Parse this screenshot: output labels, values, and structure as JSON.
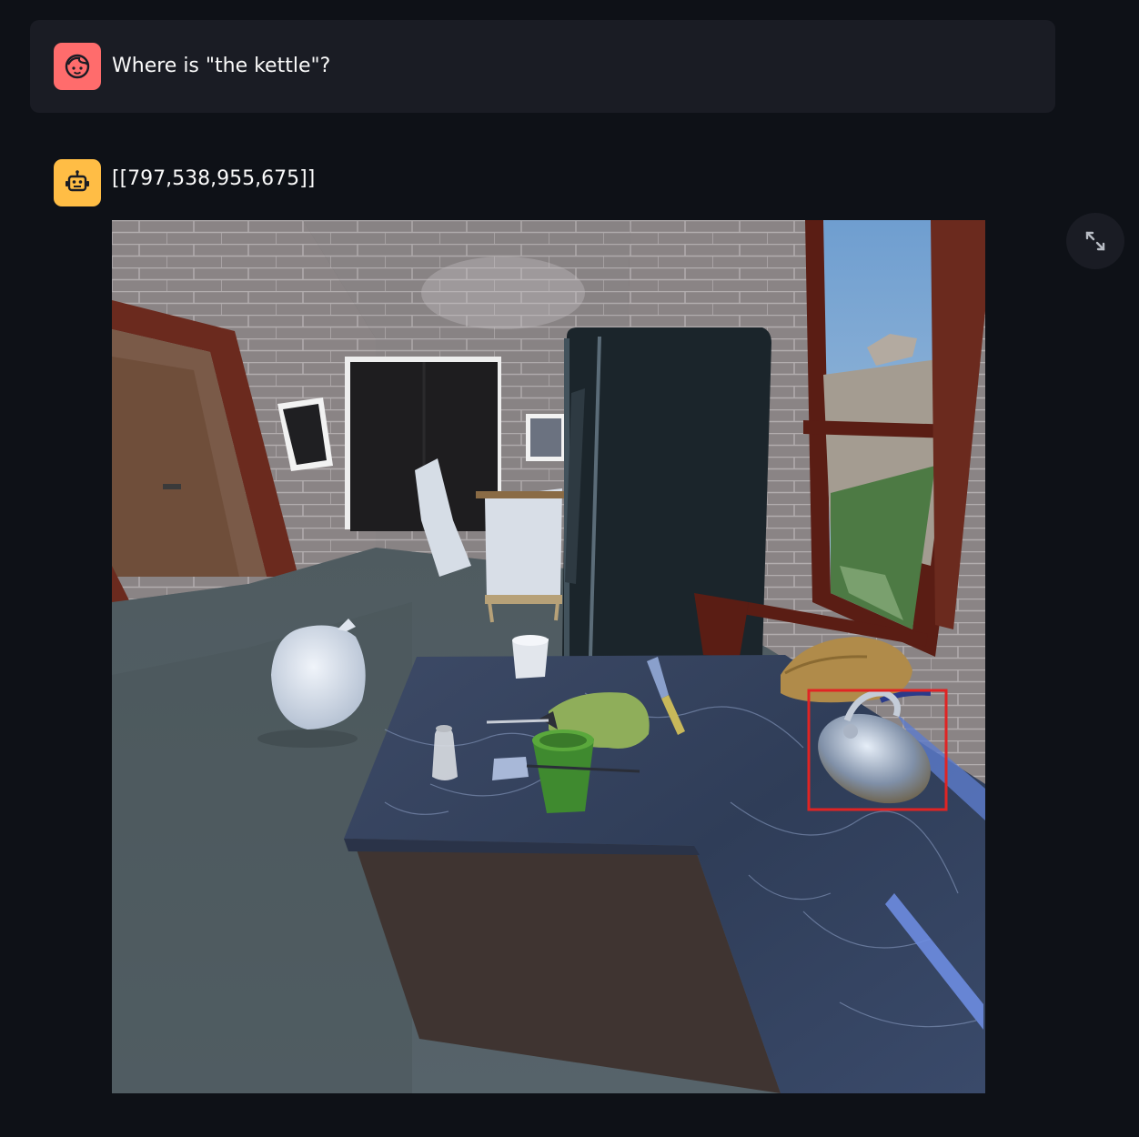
{
  "user_message": {
    "text": "Where is \"the kettle\"?",
    "avatar_icon": "user-face-icon",
    "avatar_color": "#ff6c6c"
  },
  "assistant_message": {
    "text": "[[797,538,955,675]]",
    "avatar_icon": "robot-icon",
    "avatar_color": "#ffbd45"
  },
  "image_toolbar": {
    "fullscreen_icon": "expand-icon"
  },
  "highlight": {
    "color": "#e02424",
    "target": "kettle"
  }
}
